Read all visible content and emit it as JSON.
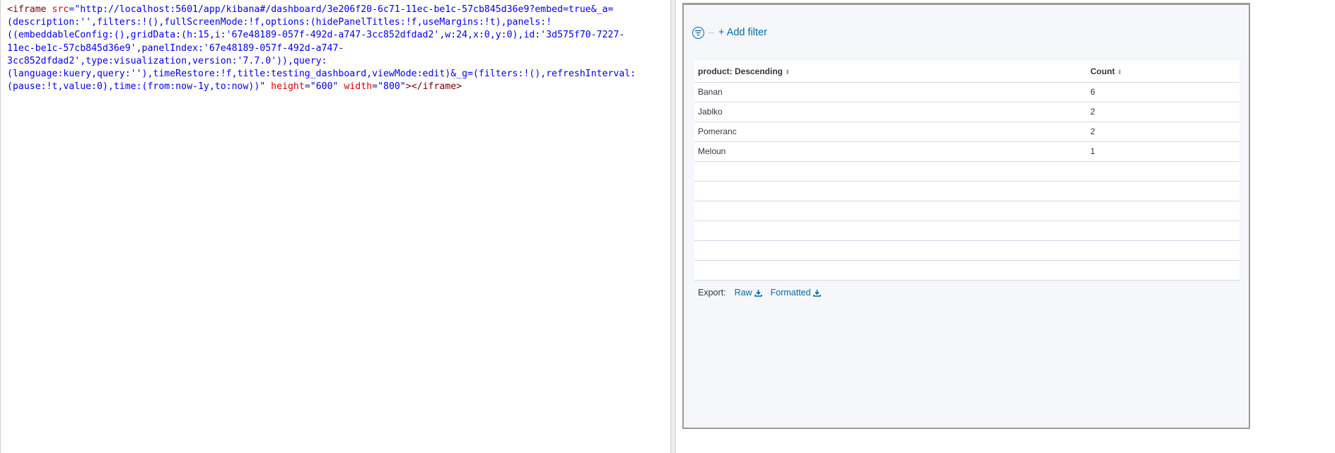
{
  "code": {
    "lines": [
      [
        {
          "c": "c-tag",
          "t": "<iframe "
        },
        {
          "c": "c-attr",
          "t": "src"
        },
        {
          "c": "",
          "t": "="
        },
        {
          "c": "c-val",
          "t": "\"http://localhost:5601/app/kibana#/dashboard/3e206f20-6c71-11ec-be1c-57cb845d36e9?embed=true&_a="
        }
      ],
      [
        {
          "c": "c-val",
          "t": "(description:'',filters:!(),fullScreenMode:!f,options:(hidePanelTitles:!f,useMargins:!t),panels:!"
        }
      ],
      [
        {
          "c": "c-val",
          "t": "((embeddableConfig:(),gridData:(h:15,i:'67e48189-057f-492d-a747-3cc852dfdad2',w:24,x:0,y:0),id:'3d575f70-7227-"
        }
      ],
      [
        {
          "c": "c-val",
          "t": "11ec-be1c-57cb845d36e9',panelIndex:'67e48189-057f-492d-a747-"
        }
      ],
      [
        {
          "c": "c-val",
          "t": "3cc852dfdad2',type:visualization,version:'7.7.0')),query:"
        }
      ],
      [
        {
          "c": "c-val",
          "t": "(language:kuery,query:''),timeRestore:!f,title:testing_dashboard,viewMode:edit)&_g=(filters:!(),refreshInterval:"
        }
      ],
      [
        {
          "c": "c-val",
          "t": "(pause:!t,value:0),time:(from:now-1y,to:now))\" "
        },
        {
          "c": "c-attr",
          "t": "height"
        },
        {
          "c": "",
          "t": "="
        },
        {
          "c": "c-val",
          "t": "\"600\" "
        },
        {
          "c": "c-attr",
          "t": "width"
        },
        {
          "c": "",
          "t": "="
        },
        {
          "c": "c-val",
          "t": "\"800\""
        },
        {
          "c": "c-tag",
          "t": "></iframe>"
        }
      ]
    ]
  },
  "preview": {
    "add_filter_label": "+ Add filter",
    "table": {
      "columns": [
        "product: Descending",
        "Count"
      ],
      "rows": [
        [
          "Banan",
          "6"
        ],
        [
          "Jablko",
          "2"
        ],
        [
          "Pomeranc",
          "2"
        ],
        [
          "Meloun",
          "1"
        ]
      ],
      "empty_rows": 6
    },
    "export": {
      "label": "Export:",
      "raw_label": "Raw",
      "formatted_label": "Formatted"
    }
  },
  "colors": {
    "link": "#006bb4",
    "frame_bg": "#f5f7fa"
  }
}
